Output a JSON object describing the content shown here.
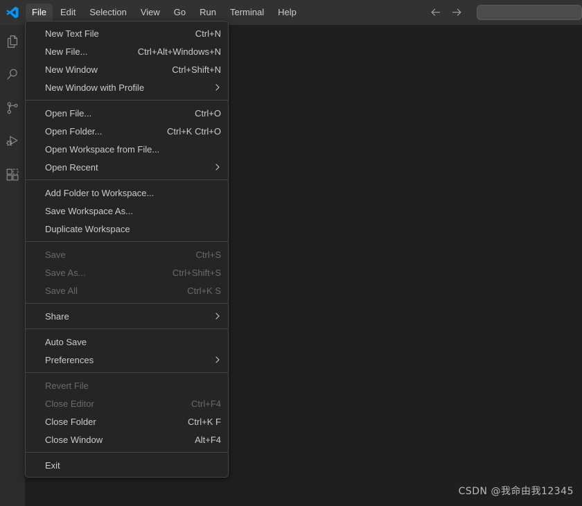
{
  "colors": {
    "titlebar_bg": "#323233",
    "activitybar_bg": "#2c2c2c",
    "editor_bg": "#1f1f1f",
    "menu_bg": "#252526",
    "menu_border": "#454545",
    "text": "#cccccc",
    "text_disabled": "#6b6b6b",
    "accent_logo": "#0098ff",
    "menubar_active_bg": "#3f3f3f"
  },
  "titlebar": {
    "logo_icon": "vscode-logo-icon",
    "menus": [
      {
        "label": "File",
        "active": true
      },
      {
        "label": "Edit",
        "active": false
      },
      {
        "label": "Selection",
        "active": false
      },
      {
        "label": "View",
        "active": false
      },
      {
        "label": "Go",
        "active": false
      },
      {
        "label": "Run",
        "active": false
      },
      {
        "label": "Terminal",
        "active": false
      },
      {
        "label": "Help",
        "active": false
      }
    ],
    "nav_back_icon": "arrow-left-icon",
    "nav_forward_icon": "arrow-right-icon",
    "command_center": {
      "value": "",
      "placeholder": ""
    }
  },
  "activitybar": {
    "items": [
      {
        "icon": "explorer-files-icon",
        "label": "Explorer"
      },
      {
        "icon": "search-icon",
        "label": "Search"
      },
      {
        "icon": "source-control-icon",
        "label": "Source Control"
      },
      {
        "icon": "run-and-debug-icon",
        "label": "Run and Debug"
      },
      {
        "icon": "extensions-icon",
        "label": "Extensions"
      }
    ]
  },
  "file_menu": {
    "groups": [
      {
        "items": [
          {
            "label": "New Text File",
            "keybinding": "Ctrl+N",
            "submenu": false,
            "disabled": false
          },
          {
            "label": "New File...",
            "keybinding": "Ctrl+Alt+Windows+N",
            "submenu": false,
            "disabled": false
          },
          {
            "label": "New Window",
            "keybinding": "Ctrl+Shift+N",
            "submenu": false,
            "disabled": false
          },
          {
            "label": "New Window with Profile",
            "keybinding": "",
            "submenu": true,
            "disabled": false
          }
        ]
      },
      {
        "items": [
          {
            "label": "Open File...",
            "keybinding": "Ctrl+O",
            "submenu": false,
            "disabled": false
          },
          {
            "label": "Open Folder...",
            "keybinding": "Ctrl+K Ctrl+O",
            "submenu": false,
            "disabled": false
          },
          {
            "label": "Open Workspace from File...",
            "keybinding": "",
            "submenu": false,
            "disabled": false
          },
          {
            "label": "Open Recent",
            "keybinding": "",
            "submenu": true,
            "disabled": false
          }
        ]
      },
      {
        "items": [
          {
            "label": "Add Folder to Workspace...",
            "keybinding": "",
            "submenu": false,
            "disabled": false
          },
          {
            "label": "Save Workspace As...",
            "keybinding": "",
            "submenu": false,
            "disabled": false
          },
          {
            "label": "Duplicate Workspace",
            "keybinding": "",
            "submenu": false,
            "disabled": false
          }
        ]
      },
      {
        "items": [
          {
            "label": "Save",
            "keybinding": "Ctrl+S",
            "submenu": false,
            "disabled": true
          },
          {
            "label": "Save As...",
            "keybinding": "Ctrl+Shift+S",
            "submenu": false,
            "disabled": true
          },
          {
            "label": "Save All",
            "keybinding": "Ctrl+K S",
            "submenu": false,
            "disabled": true
          }
        ]
      },
      {
        "items": [
          {
            "label": "Share",
            "keybinding": "",
            "submenu": true,
            "disabled": false
          }
        ]
      },
      {
        "items": [
          {
            "label": "Auto Save",
            "keybinding": "",
            "submenu": false,
            "disabled": false
          },
          {
            "label": "Preferences",
            "keybinding": "",
            "submenu": true,
            "disabled": false
          }
        ]
      },
      {
        "items": [
          {
            "label": "Revert File",
            "keybinding": "",
            "submenu": false,
            "disabled": true
          },
          {
            "label": "Close Editor",
            "keybinding": "Ctrl+F4",
            "submenu": false,
            "disabled": true
          },
          {
            "label": "Close Folder",
            "keybinding": "Ctrl+K F",
            "submenu": false,
            "disabled": false
          },
          {
            "label": "Close Window",
            "keybinding": "Alt+F4",
            "submenu": false,
            "disabled": false
          }
        ]
      },
      {
        "items": [
          {
            "label": "Exit",
            "keybinding": "",
            "submenu": false,
            "disabled": false
          }
        ]
      }
    ]
  },
  "watermark": {
    "text": "CSDN @我命由我12345"
  }
}
